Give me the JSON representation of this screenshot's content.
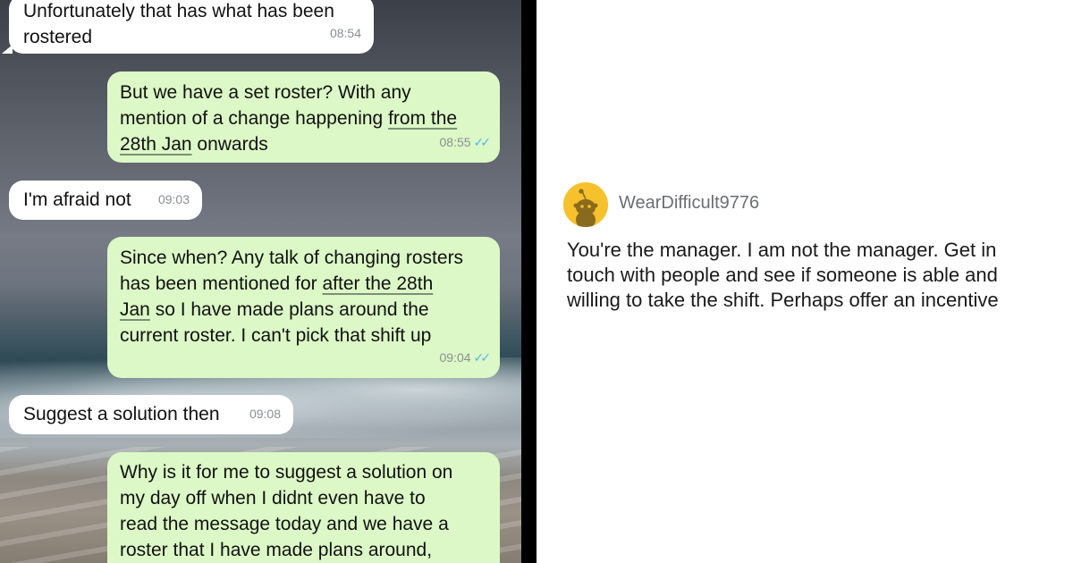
{
  "chat": {
    "messages": [
      {
        "direction": "in",
        "lines": [
          "Unfortunately that has what has been",
          "rostered"
        ],
        "time": "08:54"
      },
      {
        "direction": "out",
        "text_a": "But we have a set roster? With any\nmention of a change happening ",
        "text_u1": "from the",
        "text_b": "\n",
        "text_u2": "28th Jan",
        "text_c": " onwards",
        "time": "08:55",
        "ticks": "✓✓"
      },
      {
        "direction": "in",
        "lines": [
          "I'm afraid not"
        ],
        "time": "09:03"
      },
      {
        "direction": "out",
        "text_a": "Since when? Any talk of changing rosters\nhas been mentioned for ",
        "text_u1": "after the 28th",
        "text_b": "\n",
        "text_u2": "Jan",
        "text_c": " so I have made plans around the\ncurrent roster. I can't pick that shift up",
        "time": "09:04",
        "ticks": "✓✓"
      },
      {
        "direction": "in",
        "lines": [
          "Suggest a solution then"
        ],
        "time": "09:08"
      },
      {
        "direction": "out",
        "text": "Why is it for me to suggest a solution on\nmy day off when I didnt even have to\nread the message today and we have a\nroster that I have made plans around,"
      }
    ]
  },
  "comment": {
    "username": "WearDifficult9776",
    "avatar_icon": "reddit-snoo-icon",
    "body": "You're the manager.  I am not the manager.  Get in\ntouch with people and see if someone is able and\nwilling to take the shift.  Perhaps offer an incentive"
  },
  "colors": {
    "incoming_bubble": "#ffffff",
    "outgoing_bubble": "#dcf8c6",
    "read_ticks": "#4fb6ec",
    "avatar_bg": "#f6c12c"
  }
}
